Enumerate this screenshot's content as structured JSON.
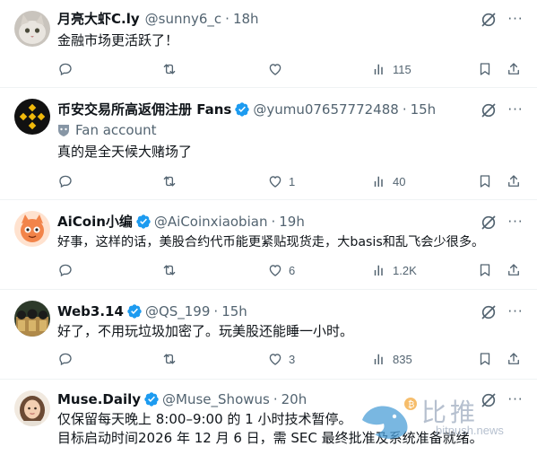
{
  "tweets": [
    {
      "name": "月亮大虾C.ly",
      "handle": "@sunny6_c",
      "time": "18h",
      "text": "金融市场更活跃了！",
      "verified": false,
      "views": "115",
      "likes": "",
      "avatar_icon": "cat-avatar"
    },
    {
      "name": "币安交易所高返佣注册 Fans",
      "handle": "@yumu07657772488",
      "time": "15h",
      "fan_label": "Fan account",
      "text": "真的是全天候大赌场了",
      "verified": true,
      "likes": "1",
      "views": "40",
      "avatar_icon": "binance-logo-avatar"
    },
    {
      "name": "AiCoin小编",
      "handle": "@AiCoinxiaobian",
      "time": "19h",
      "text": "好事，这样的话，美股合约代币能更紧贴现货走，大basis和乱飞会少很多。",
      "verified": true,
      "likes": "6",
      "views": "1.2K",
      "avatar_icon": "mascot-avatar"
    },
    {
      "name": "Web3.14",
      "handle": "@QS_199",
      "time": "15h",
      "text": "好了，不用玩垃圾加密了。玩美股还能睡一小时。",
      "verified": true,
      "likes": "3",
      "views": "835",
      "avatar_icon": "group-avatar"
    },
    {
      "name": "Muse.Daily",
      "handle": "@Muse_Showus",
      "time": "20h",
      "text_lines": [
        "仅保留每天晚上 8:00–9:00 的 1 小时技术暂停。",
        "目标启动时间2026 年 12 月 6 日，需 SEC 最终批准及系统准备就绪。"
      ],
      "verified": true,
      "avatar_icon": "woman-avatar"
    }
  ],
  "watermark": {
    "text": "比推",
    "url": "bitpush.news"
  },
  "colors": {
    "verified": "#1d9bf0",
    "muted": "#536471",
    "text": "#0f1419",
    "divider": "#eff3f4"
  }
}
